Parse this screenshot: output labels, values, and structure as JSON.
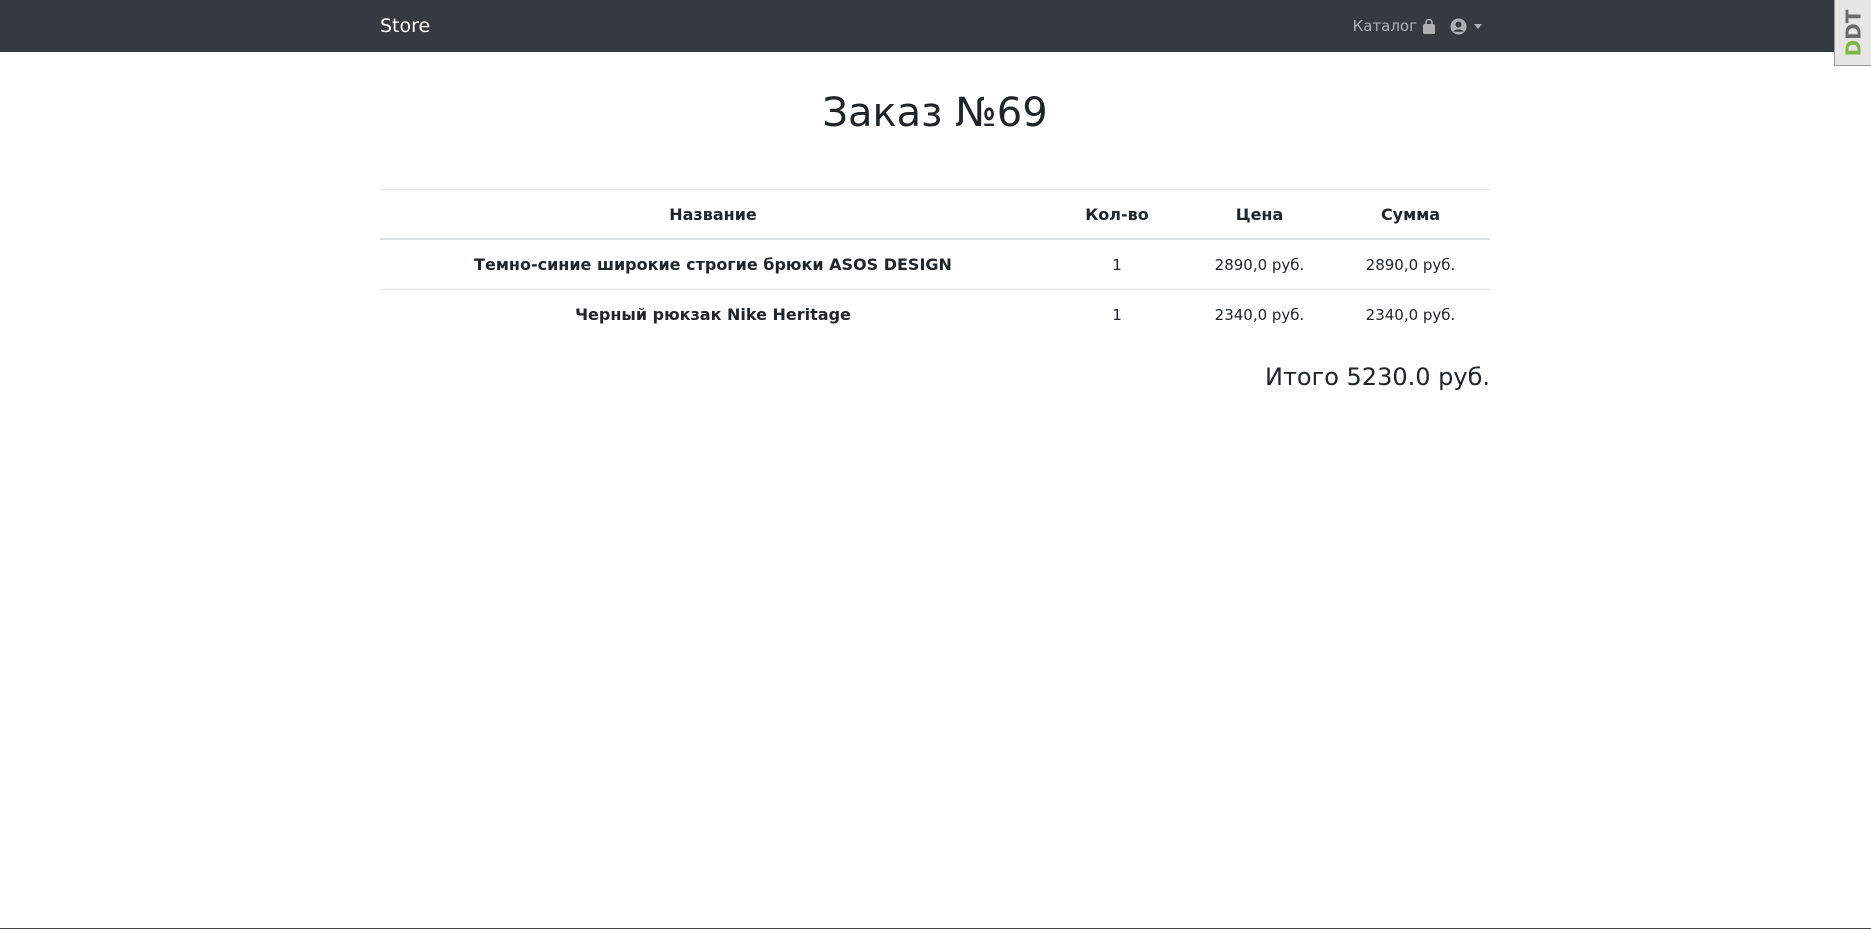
{
  "navbar": {
    "brand": "Store",
    "catalog_label": "Каталог",
    "catalog_icon": "shopping-bag-icon",
    "user_icon": "user-circle-icon"
  },
  "badge": {
    "text_part1": "D",
    "text_part2": "DT"
  },
  "order": {
    "title": "Заказ №69",
    "table": {
      "headers": {
        "name": "Название",
        "qty": "Кол-во",
        "price": "Цена",
        "sum": "Сумма"
      },
      "rows": [
        {
          "name": "Темно-синие широкие строгие брюки ASOS DESIGN",
          "qty": "1",
          "price": "2890,0 руб.",
          "sum": "2890,0 руб."
        },
        {
          "name": "Черный рюкзак Nike Heritage",
          "qty": "1",
          "price": "2340,0 руб.",
          "sum": "2340,0 руб."
        }
      ]
    },
    "total": "Итого 5230.0 руб."
  },
  "colors": {
    "navbar_bg": "#343a40",
    "text": "#212529",
    "border": "#dee2e6"
  }
}
